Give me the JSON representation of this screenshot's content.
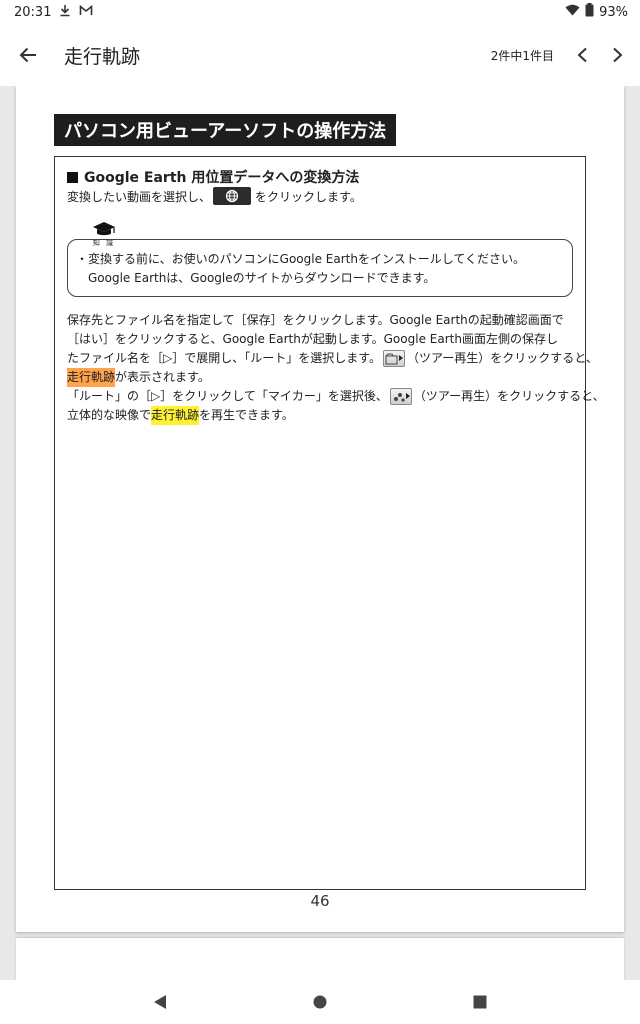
{
  "status_bar": {
    "time": "20:31",
    "battery": "93%",
    "icons": [
      "download-icon",
      "gmail-icon",
      "wifi-icon",
      "battery-icon"
    ]
  },
  "app_bar": {
    "title": "走行軌跡",
    "page_count": "2件中1件目"
  },
  "document": {
    "section_title": "パソコン用ビューアーソフトの操作方法",
    "subheading": "Google Earth 用位置データへの変換方法",
    "instruction_before": "変換したい動画を選択し、",
    "instruction_after": "をクリックします。",
    "tip_label": "知 識",
    "tip_bullet": "・",
    "tip_line1": "変換する前に、お使いのパソコンにGoogle Earthをインストールしてください。",
    "tip_line2": "Google Earthは、Googleのサイトからダウンロードできます。",
    "body_line1": "保存先とファイル名を指定して［保存］をクリックします。Google Earthの起動確認画面で",
    "body_line2": "［はい］をクリックすると、Google Earthが起動します。Google Earth画面左側の保存し",
    "body_line3a": "たファイル名を［▷］で展開し、「ルート」を選択します。",
    "body_line3b": "（ツアー再生）をクリックすると、",
    "body_line4_hl": "走行軌跡",
    "body_line4_rest": "が表示されます。",
    "body_line5a": "「ルート」の［▷］をクリックして「マイカー」を選択後、",
    "body_line5b": "（ツアー再生）をクリックすると、",
    "body_line6a": "立体的な映像で",
    "body_line6_hl": "走行軌跡",
    "body_line6b": "を再生できます。",
    "page_number": "46"
  },
  "colors": {
    "highlight_orange": "#ffa34d",
    "highlight_yellow": "#fff233",
    "title_bg": "#1e1e1e"
  },
  "nav_bar": {
    "icons": [
      "back-triangle-icon",
      "home-circle-icon",
      "recents-square-icon"
    ]
  }
}
